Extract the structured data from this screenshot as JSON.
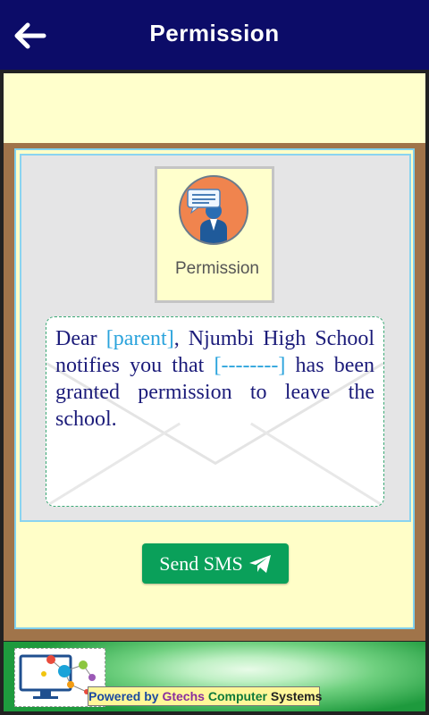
{
  "header": {
    "title": "Permission",
    "back_icon": "arrow-left-icon",
    "background": "#0c0c68"
  },
  "permission_card": {
    "label": "Permission",
    "icon": "speech-bubble-person-icon",
    "circle_color": "#f0844e"
  },
  "message": {
    "part1": "Dear ",
    "parent_placeholder": "[parent]",
    "part2": ", Njumbi High School notifies you that ",
    "student_placeholder": "[--------]",
    "part3": " has been granted permission to leave the school.",
    "placeholder_color": "#2aa3dc"
  },
  "send_button": {
    "label": "Send SMS",
    "icon": "paper-plane-icon",
    "color": "#0aa05a"
  },
  "footer": {
    "powered_by": "Powered by ",
    "brand": "Gtechs",
    "company_word": " Computer",
    "systems_word": " Systems",
    "logo_icon": "computer-network-logo-icon"
  }
}
